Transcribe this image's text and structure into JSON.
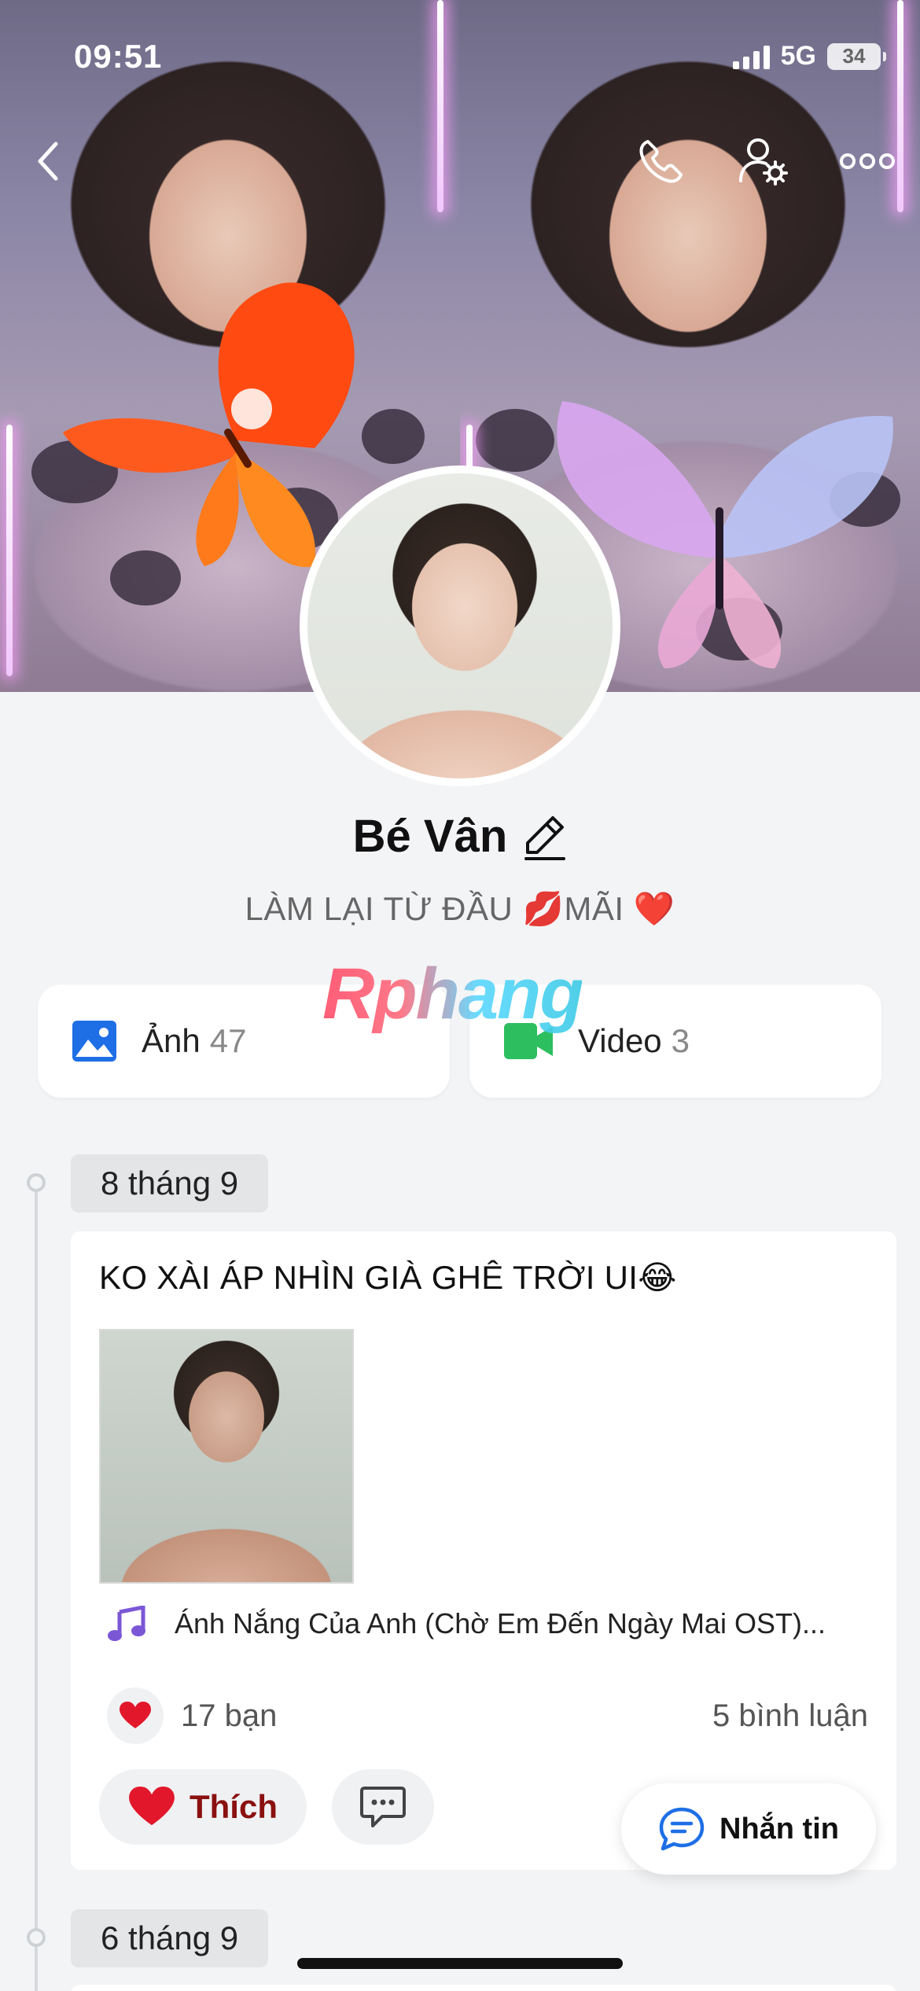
{
  "status_bar": {
    "time": "09:51",
    "network": "5G",
    "battery": "34"
  },
  "header": {
    "back_icon": "chevron-left-icon",
    "call_icon": "phone-icon",
    "settings_icon": "user-gear-icon",
    "more_icon": "more-dots-icon"
  },
  "profile": {
    "name": "Bé Vân",
    "bio": "LÀM LẠI TỪ ĐẦU 💋MÃI ❤️"
  },
  "watermark": "Rphang",
  "media": {
    "photos_label": "Ảnh",
    "photos_count": "47",
    "videos_label": "Video",
    "videos_count": "3"
  },
  "timeline": [
    {
      "date": "8 tháng 9",
      "text": "KO XÀI ÁP NHÌN GIÀ GHÊ TRỜI UI😂",
      "music": "Ánh Nắng Của Anh (Chờ Em Đến Ngày Mai OST)...",
      "likes": "17 bạn",
      "comments": "5 bình luận",
      "like_label": "Thích"
    },
    {
      "date": "6 tháng 9"
    }
  ],
  "message_button": "Nhắn tin",
  "colors": {
    "accent_blue": "#1e6fe6",
    "video_green": "#2dbe60",
    "like_red": "#e3172b",
    "music_purple": "#7b57d6"
  }
}
